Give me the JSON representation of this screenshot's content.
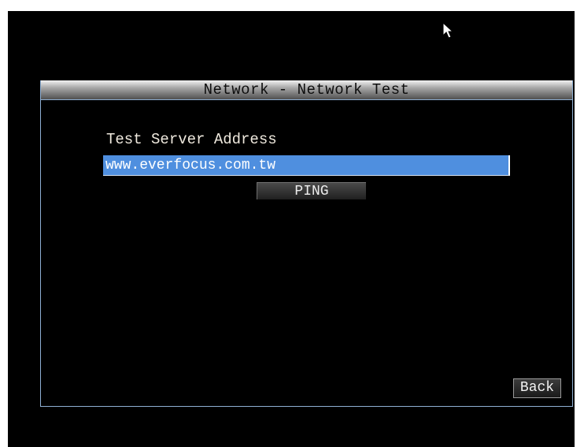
{
  "dialog": {
    "title": "Network - Network Test"
  },
  "network_test": {
    "field_label": "Test Server Address",
    "address_value": "www.everfocus.com.tw",
    "ping_label": "PING"
  },
  "footer": {
    "back_label": "Back"
  },
  "colors": {
    "screen_background": "#000000",
    "dialog_border": "#8fb0d4",
    "input_highlight": "#4f8fdf",
    "text": "#efe9de"
  },
  "icons": {
    "cursor": "mouse-pointer-arrow"
  }
}
